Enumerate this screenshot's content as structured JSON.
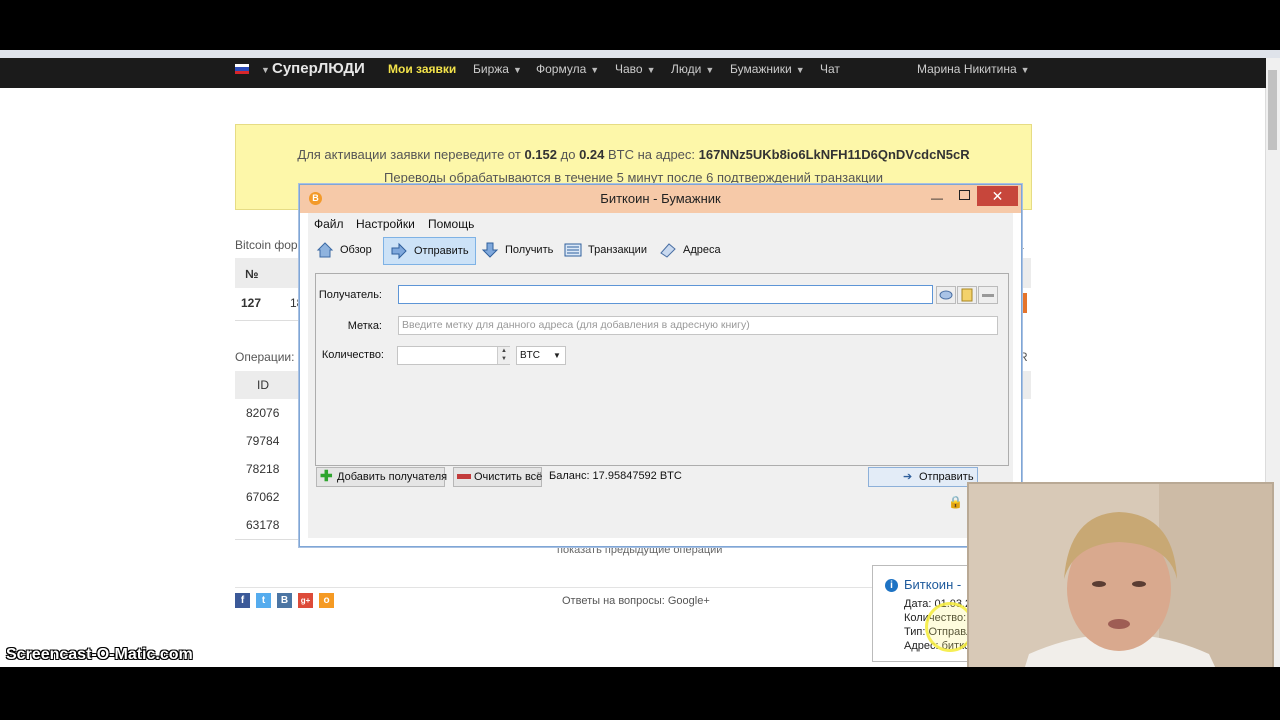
{
  "navbar": {
    "brand": "СуперЛЮДИ",
    "items": [
      "Мои заявки",
      "Биржа",
      "Формула",
      "Чаво",
      "Люди",
      "Бумажники",
      "Чат"
    ],
    "user": "Марина Никитина"
  },
  "alert": {
    "prefix": "Для активации заявки переведите от",
    "min": "0.152",
    "mid": "до",
    "max": "0.24",
    "currency_text": "BTC на адрес:",
    "address": "167NNz5UKb8io6LkNFH11D6QnDVcdcN5cR",
    "line2": "Переводы обрабатываются в течение 5 минут после 6 подтверждений транзакции"
  },
  "page": {
    "bitcoin_label": "Bitcoin форм",
    "table1_header": "№",
    "table1_row": {
      "num": "127",
      "rest": "18"
    },
    "ops_label": "Операции:",
    "ops_header": "ID",
    "ops_ids": [
      "82076",
      "79784",
      "78218",
      "67062",
      "63178"
    ],
    "right_col_a": "а",
    "right_col_r": "R",
    "show_prev": "показать предыдущие операции",
    "footer_text": "Ответы на вопросы: Google+",
    "social": [
      "f",
      "t",
      "B",
      "g+",
      "o"
    ]
  },
  "wallet": {
    "title": "Биткоин - Бумажник",
    "menu": [
      "Файл",
      "Настройки",
      "Помощь"
    ],
    "toolbar": [
      "Обзор",
      "Отправить",
      "Получить",
      "Транзакции",
      "Адреса"
    ],
    "recipient_label": "Получатель:",
    "recipient_value": "",
    "label_label": "Метка:",
    "label_placeholder": "Введите метку для данного адреса (для добавления в адресную книгу)",
    "amount_label": "Количество:",
    "amount_value": "",
    "unit": "BTC",
    "add_recipient": "Добавить получателя",
    "clear_all": "Очистить всё",
    "balance": "Баланс: 17.95847592 BTC",
    "send": "Отправить"
  },
  "notification": {
    "title": "Биткоин -",
    "lines": [
      "Дата: 01.03.2",
      "Количество:",
      "Тип: Отправл",
      "Адрес: битко"
    ]
  },
  "watermark": "Screencast-O-Matic.com",
  "colors": {
    "alert_bg": "#fdf7a9",
    "navbar_bg": "#1b1b1b",
    "nav_active": "#f2e24a",
    "titlebar": "#f6c9a8",
    "close": "#c7463b"
  }
}
